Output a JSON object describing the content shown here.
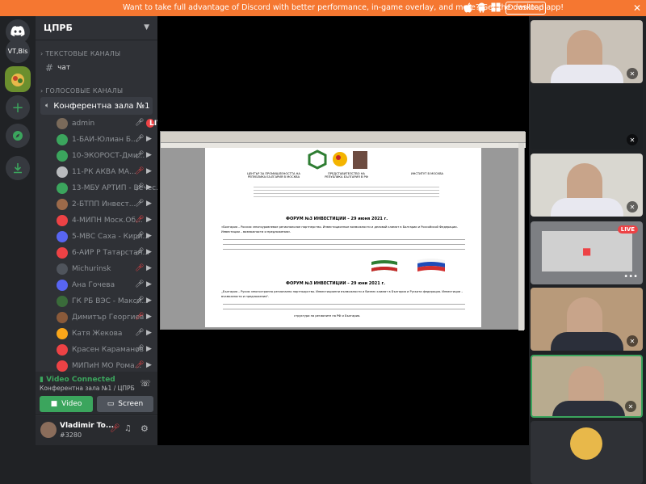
{
  "banner": {
    "message": "Want to take full advantage of Discord with better performance, in-game overlay, and more? Get the desktop app!",
    "download_label": "Download",
    "close_symbol": "✕"
  },
  "servers": [
    {
      "label": "VT,Bls"
    }
  ],
  "server": {
    "name": "ЦПРБ"
  },
  "categories": {
    "text": "ТЕКСТОВЫЕ КАНАЛЫ",
    "voice": "ГОЛОСОВЫЕ КАНАЛЫ"
  },
  "text_channels": [
    {
      "name": "чат"
    }
  ],
  "voice_channel": {
    "name": "Конферентна зала №1"
  },
  "voice_users": [
    {
      "name": "admin",
      "live": "LIVE"
    },
    {
      "name": "1-БАИ-Юлиан Б..."
    },
    {
      "name": "10-ЭКОРОСТ-Дми..."
    },
    {
      "name": "11-РК АКВА МА..."
    },
    {
      "name": "13-МБУ АРТИП - Вечес..."
    },
    {
      "name": "2-БТПП Инвест..."
    },
    {
      "name": "4-МИПН Моск.Об..."
    },
    {
      "name": "5-МВС Саха - Кири..."
    },
    {
      "name": "6-АИР Р Татарстан..."
    },
    {
      "name": "Michurinsk"
    },
    {
      "name": "Ана Гочева"
    },
    {
      "name": "ГК РБ ВЭС - Макси..."
    },
    {
      "name": "Димитър Георгиев"
    },
    {
      "name": "Катя Жекова"
    },
    {
      "name": "Красен Караманов"
    },
    {
      "name": "МИПиН МО Рома..."
    }
  ],
  "voice_panel": {
    "status": "Video Connected",
    "location": "Конферентна зала №1 / ЦПРБ",
    "video_label": "Video",
    "screen_label": "Screen"
  },
  "user_panel": {
    "name": "Vladimir To...",
    "tag": "#3280"
  },
  "document": {
    "org_left": "ЦЕНТЪР ЗА ПРОМИШЛЕНОСТТА НА РЕПУБЛИКА БЪЛГАРИЯ В МОСКВА",
    "org_center": "ПРЕДСТАВИТЕЛСТВО НА РЕПУБЛИКА БЪЛГАРИЯ В РФ",
    "org_right": "ИНСТИТУТ В МОСКВА",
    "forum_ru": "ФОРУМ №3 ИНВЕСТИЦИИ – 29 июня 2021 г.",
    "line_ru": "«Болгария – Россия: многоуровневое региональное партнерство. Инвестиционные возможности и деловой климат в Болгарии и Российской Федерации. Инвестиции – возможности и предложения».",
    "forum_bg": "ФОРУМ №3 ИНВЕСТИЦИИ – 29 юни 2021 г.",
    "line_bg": "„България – Русия: многостранно регионално партньорство. Инвестиционни възможности и бизнес климат в България и Руската федерация. Инвестиции – възможности и предложения\".",
    "footer_bg": "структури на регионите на РФ и България."
  },
  "tiles": [
    {
      "kind": "person"
    },
    {
      "kind": "dark"
    },
    {
      "kind": "person"
    },
    {
      "kind": "stream",
      "live": "LIVE"
    },
    {
      "kind": "person"
    },
    {
      "kind": "person"
    },
    {
      "kind": "avatar"
    }
  ],
  "colors": {
    "banner": "#f57731",
    "accent_green": "#3ba55d",
    "live_red": "#ed4245"
  }
}
